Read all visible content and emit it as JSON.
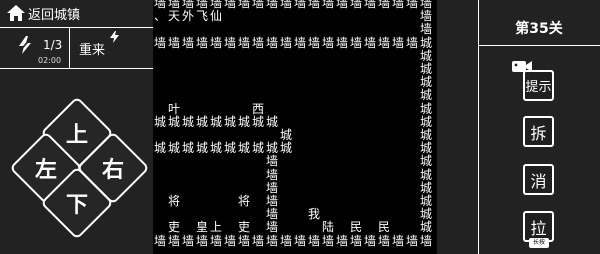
{
  "left": {
    "back_label": "返回城镇",
    "energy": {
      "count": "1/3",
      "timer": "02:00"
    },
    "restart_label": "重来",
    "dpad": {
      "up": "上",
      "left": "左",
      "right": "右",
      "down": "下"
    }
  },
  "right": {
    "level": "第35关",
    "hint": "提示",
    "demolish": "拆",
    "eliminate": "消",
    "pull": "拉",
    "pull_tag": "长按"
  },
  "board": {
    "cells": [
      {
        "t": "墙",
        "r": 0,
        "c": 0
      },
      {
        "t": "墙",
        "r": 0,
        "c": 1
      },
      {
        "t": "墙",
        "r": 0,
        "c": 2
      },
      {
        "t": "墙",
        "r": 0,
        "c": 3
      },
      {
        "t": "墙",
        "r": 0,
        "c": 4
      },
      {
        "t": "墙",
        "r": 0,
        "c": 5
      },
      {
        "t": "墙",
        "r": 0,
        "c": 6
      },
      {
        "t": "墙",
        "r": 0,
        "c": 7
      },
      {
        "t": "墙",
        "r": 0,
        "c": 8
      },
      {
        "t": "墙",
        "r": 0,
        "c": 9
      },
      {
        "t": "墙",
        "r": 0,
        "c": 10
      },
      {
        "t": "墙",
        "r": 0,
        "c": 11
      },
      {
        "t": "墙",
        "r": 0,
        "c": 12
      },
      {
        "t": "墙",
        "r": 0,
        "c": 13
      },
      {
        "t": "墙",
        "r": 0,
        "c": 14
      },
      {
        "t": "墙",
        "r": 0,
        "c": 15
      },
      {
        "t": "墙",
        "r": 0,
        "c": 16
      },
      {
        "t": "墙",
        "r": 0,
        "c": 17
      },
      {
        "t": "墙",
        "r": 0,
        "c": 18
      },
      {
        "t": "墙",
        "r": 0,
        "c": 19
      },
      {
        "t": "、",
        "r": 1,
        "c": 0
      },
      {
        "t": "天",
        "r": 1,
        "c": 1
      },
      {
        "t": "外",
        "r": 1,
        "c": 2
      },
      {
        "t": "飞",
        "r": 1,
        "c": 3
      },
      {
        "t": "仙",
        "r": 1,
        "c": 4
      },
      {
        "t": "墙",
        "r": 1,
        "c": 19
      },
      {
        "t": "墙",
        "r": 2,
        "c": 19
      },
      {
        "t": "墙",
        "r": 3,
        "c": 0
      },
      {
        "t": "墙",
        "r": 3,
        "c": 1
      },
      {
        "t": "墙",
        "r": 3,
        "c": 2
      },
      {
        "t": "墙",
        "r": 3,
        "c": 3
      },
      {
        "t": "墙",
        "r": 3,
        "c": 4
      },
      {
        "t": "墙",
        "r": 3,
        "c": 5
      },
      {
        "t": "墙",
        "r": 3,
        "c": 6
      },
      {
        "t": "墙",
        "r": 3,
        "c": 7
      },
      {
        "t": "墙",
        "r": 3,
        "c": 8
      },
      {
        "t": "墙",
        "r": 3,
        "c": 9
      },
      {
        "t": "墙",
        "r": 3,
        "c": 10
      },
      {
        "t": "墙",
        "r": 3,
        "c": 11
      },
      {
        "t": "墙",
        "r": 3,
        "c": 12
      },
      {
        "t": "墙",
        "r": 3,
        "c": 13
      },
      {
        "t": "墙",
        "r": 3,
        "c": 14
      },
      {
        "t": "墙",
        "r": 3,
        "c": 15
      },
      {
        "t": "墙",
        "r": 3,
        "c": 16
      },
      {
        "t": "墙",
        "r": 3,
        "c": 17
      },
      {
        "t": "墙",
        "r": 3,
        "c": 18
      },
      {
        "t": "城",
        "r": 3,
        "c": 19
      },
      {
        "t": "城",
        "r": 4,
        "c": 19
      },
      {
        "t": "城",
        "r": 5,
        "c": 19
      },
      {
        "t": "城",
        "r": 6,
        "c": 19
      },
      {
        "t": "城",
        "r": 7,
        "c": 19
      },
      {
        "t": "叶",
        "r": 8,
        "c": 1
      },
      {
        "t": "西",
        "r": 8,
        "c": 7
      },
      {
        "t": "城",
        "r": 8,
        "c": 19
      },
      {
        "t": "城",
        "r": 9,
        "c": 0
      },
      {
        "t": "城",
        "r": 9,
        "c": 1
      },
      {
        "t": "城",
        "r": 9,
        "c": 2
      },
      {
        "t": "城",
        "r": 9,
        "c": 3
      },
      {
        "t": "城",
        "r": 9,
        "c": 4
      },
      {
        "t": "城",
        "r": 9,
        "c": 5
      },
      {
        "t": "城",
        "r": 9,
        "c": 6
      },
      {
        "t": "城",
        "r": 9,
        "c": 7
      },
      {
        "t": "城",
        "r": 9,
        "c": 8
      },
      {
        "t": "城",
        "r": 9,
        "c": 19
      },
      {
        "t": "城",
        "r": 10,
        "c": 9
      },
      {
        "t": "城",
        "r": 10,
        "c": 19
      },
      {
        "t": "城",
        "r": 11,
        "c": 0
      },
      {
        "t": "城",
        "r": 11,
        "c": 1
      },
      {
        "t": "城",
        "r": 11,
        "c": 2
      },
      {
        "t": "城",
        "r": 11,
        "c": 3
      },
      {
        "t": "城",
        "r": 11,
        "c": 4
      },
      {
        "t": "城",
        "r": 11,
        "c": 5
      },
      {
        "t": "城",
        "r": 11,
        "c": 6
      },
      {
        "t": "城",
        "r": 11,
        "c": 7
      },
      {
        "t": "城",
        "r": 11,
        "c": 8
      },
      {
        "t": "城",
        "r": 11,
        "c": 9
      },
      {
        "t": "城",
        "r": 11,
        "c": 19
      },
      {
        "t": "墙",
        "r": 12,
        "c": 8
      },
      {
        "t": "城",
        "r": 12,
        "c": 19
      },
      {
        "t": "墙",
        "r": 13,
        "c": 8
      },
      {
        "t": "城",
        "r": 13,
        "c": 19
      },
      {
        "t": "墙",
        "r": 14,
        "c": 8
      },
      {
        "t": "城",
        "r": 14,
        "c": 19
      },
      {
        "t": "将",
        "r": 15,
        "c": 1
      },
      {
        "t": "将",
        "r": 15,
        "c": 6
      },
      {
        "t": "墙",
        "r": 15,
        "c": 8
      },
      {
        "t": "城",
        "r": 15,
        "c": 19
      },
      {
        "t": "墙",
        "r": 16,
        "c": 8
      },
      {
        "t": "我",
        "r": 16,
        "c": 11
      },
      {
        "t": "城",
        "r": 16,
        "c": 19
      },
      {
        "t": "吏",
        "r": 17,
        "c": 1
      },
      {
        "t": "皇",
        "r": 17,
        "c": 3
      },
      {
        "t": "上",
        "r": 17,
        "c": 4
      },
      {
        "t": "吏",
        "r": 17,
        "c": 6
      },
      {
        "t": "墙",
        "r": 17,
        "c": 8
      },
      {
        "t": "陆",
        "r": 17,
        "c": 12
      },
      {
        "t": "民",
        "r": 17,
        "c": 14
      },
      {
        "t": "民",
        "r": 17,
        "c": 16
      },
      {
        "t": "城",
        "r": 17,
        "c": 19
      },
      {
        "t": "墙",
        "r": 18,
        "c": 0
      },
      {
        "t": "墙",
        "r": 18,
        "c": 1
      },
      {
        "t": "墙",
        "r": 18,
        "c": 2
      },
      {
        "t": "墙",
        "r": 18,
        "c": 3
      },
      {
        "t": "墙",
        "r": 18,
        "c": 4
      },
      {
        "t": "墙",
        "r": 18,
        "c": 5
      },
      {
        "t": "墙",
        "r": 18,
        "c": 6
      },
      {
        "t": "墙",
        "r": 18,
        "c": 7
      },
      {
        "t": "墙",
        "r": 18,
        "c": 8
      },
      {
        "t": "墙",
        "r": 18,
        "c": 9
      },
      {
        "t": "墙",
        "r": 18,
        "c": 10
      },
      {
        "t": "墙",
        "r": 18,
        "c": 11
      },
      {
        "t": "墙",
        "r": 18,
        "c": 12
      },
      {
        "t": "墙",
        "r": 18,
        "c": 13
      },
      {
        "t": "墙",
        "r": 18,
        "c": 14
      },
      {
        "t": "墙",
        "r": 18,
        "c": 15
      },
      {
        "t": "墙",
        "r": 18,
        "c": 16
      },
      {
        "t": "墙",
        "r": 18,
        "c": 17
      },
      {
        "t": "墙",
        "r": 18,
        "c": 18
      },
      {
        "t": "墙",
        "r": 18,
        "c": 19
      }
    ]
  }
}
